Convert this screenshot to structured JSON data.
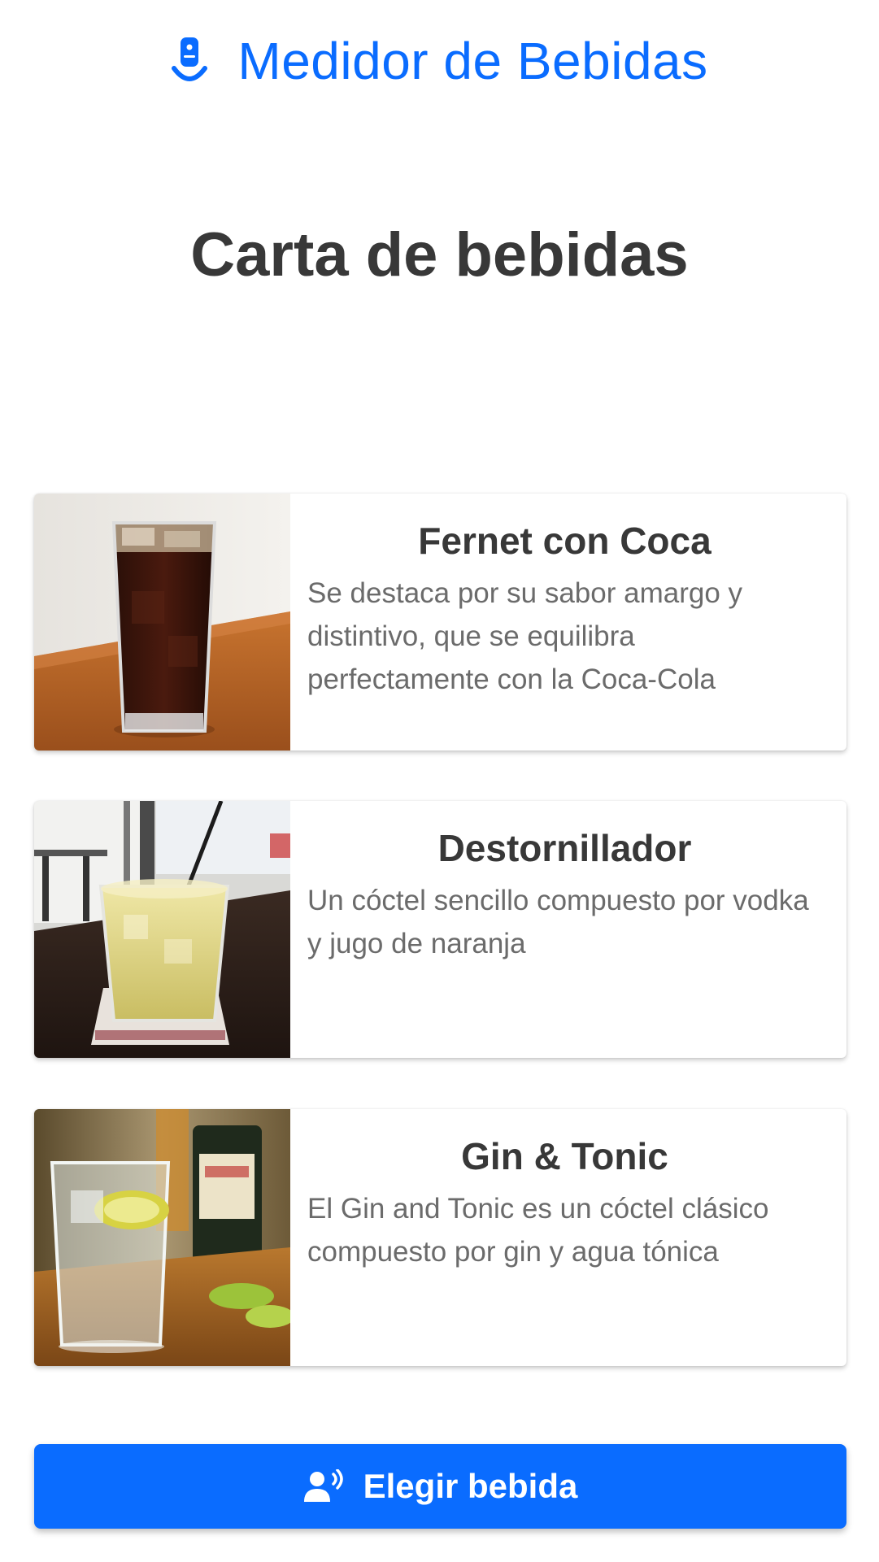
{
  "header": {
    "title": "Medidor de Bebidas",
    "icon": "glass-meter-icon",
    "accent_color": "#0a6cff"
  },
  "page": {
    "title": "Carta de bebidas"
  },
  "drinks": [
    {
      "name": "Fernet con Coca",
      "description": "Se destaca por su sabor amargo y distintivo, que se equilibra perfectamente con la Coca-Cola",
      "image": "fernet-coca-glass-photo"
    },
    {
      "name": "Destornillador",
      "description": "Un cóctel sencillo compuesto por vodka y jugo de naranja",
      "image": "screwdriver-cocktail-photo"
    },
    {
      "name": "Gin & Tonic",
      "description": "El Gin and Tonic es un cóctel clásico compuesto por gin y agua tónica",
      "image": "gin-tonic-glass-photo"
    }
  ],
  "action": {
    "label": "Elegir bebida",
    "icon": "voice-user-icon",
    "color": "#0a6cff"
  }
}
